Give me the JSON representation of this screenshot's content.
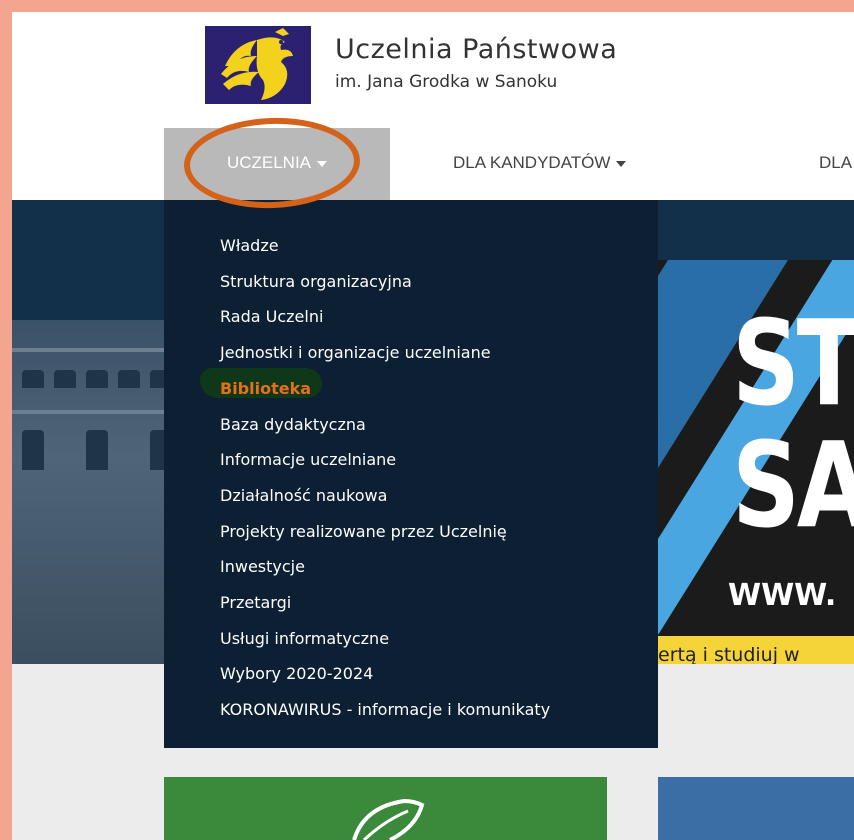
{
  "header": {
    "university_name": "Uczelnia Państwowa",
    "university_subtitle": "im. Jana Grodka w Sanoku"
  },
  "nav": {
    "items": [
      {
        "label": "UCZELNIA",
        "active": true
      },
      {
        "label": "DLA KANDYDATÓW",
        "active": false
      },
      {
        "label": "DLA",
        "active": false
      }
    ]
  },
  "dropdown": {
    "items": [
      {
        "label": "Władze"
      },
      {
        "label": "Struktura organizacyjna"
      },
      {
        "label": "Rada Uczelni"
      },
      {
        "label": "Jednostki i organizacje uczelniane"
      },
      {
        "label": "Biblioteka",
        "highlighted": true
      },
      {
        "label": "Baza dydaktyczna"
      },
      {
        "label": "Informacje uczelniane"
      },
      {
        "label": "Działalność naukowa"
      },
      {
        "label": "Projekty realizowane przez Uczelnię"
      },
      {
        "label": "Inwestycje"
      },
      {
        "label": "Przetargi"
      },
      {
        "label": "Usługi informatyczne"
      },
      {
        "label": "Wybory 2020-2024"
      },
      {
        "label": "KORONAWIRUS - informacje i komunikaty"
      }
    ]
  },
  "banner": {
    "line1": "ST",
    "line2": "SA",
    "url": "WWW.",
    "strip_text": "ertą i studiuj w"
  },
  "colors": {
    "frame": "#f4a58f",
    "dropdown_bg": "#0c1f33",
    "highlight": "#e86e18",
    "nav_active_bg": "#b9b9b9",
    "annotation_circle": "#d46218",
    "annotation_marker": "#0f3a18",
    "banner_yellow": "#f5d43a"
  },
  "icons": {
    "logo": "eagle-emblem-icon",
    "nav_caret": "caret-down-icon",
    "card_leaf": "leaf-icon"
  }
}
